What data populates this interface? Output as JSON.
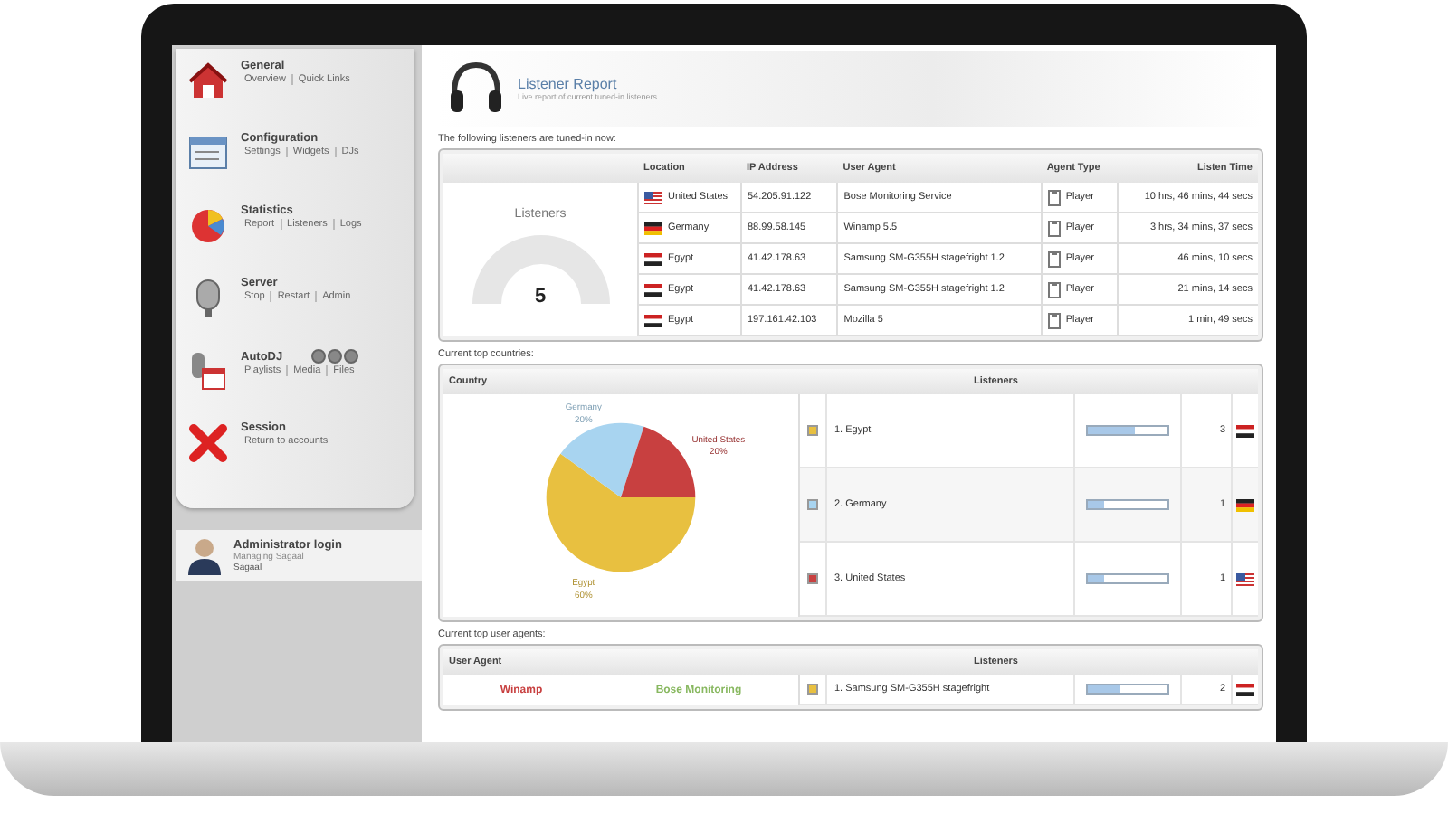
{
  "sidebar": {
    "sections": [
      {
        "kind": "home",
        "title": "General",
        "links": [
          "Overview",
          "Quick Links"
        ]
      },
      {
        "kind": "config",
        "title": "Configuration",
        "links": [
          "Settings",
          "Widgets",
          "DJs"
        ]
      },
      {
        "kind": "stats",
        "title": "Statistics",
        "links": [
          "Report",
          "Listeners",
          "Logs"
        ]
      },
      {
        "kind": "server",
        "title": "Server",
        "links": [
          "Stop",
          "Restart",
          "Admin"
        ]
      },
      {
        "kind": "autodj",
        "title": "AutoDJ",
        "links": [
          "Playlists",
          "Media",
          "Files"
        ]
      },
      {
        "kind": "session",
        "title": "Session",
        "links": [
          "Return to accounts"
        ]
      }
    ],
    "account": {
      "title": "Administrator login",
      "subtitle": "Managing Sagaal",
      "user": "Sagaal"
    }
  },
  "header": {
    "title": "Listener Report",
    "subtitle": "Live report of current tuned-in listeners"
  },
  "listeners": {
    "caption": "The following listeners are tuned-in now:",
    "gauge_label": "Listeners",
    "gauge_value": "5",
    "columns": [
      "Location",
      "IP Address",
      "User Agent",
      "Agent Type",
      "Listen Time"
    ],
    "rows": [
      {
        "kind": "us",
        "location": "United States",
        "ip": "54.205.91.122",
        "agent": "Bose Monitoring Service",
        "type": "Player",
        "time": "10 hrs, 46 mins, 44 secs"
      },
      {
        "kind": "de",
        "location": "Germany",
        "ip": "88.99.58.145",
        "agent": "Winamp 5.5",
        "type": "Player",
        "time": "3 hrs, 34 mins, 37 secs"
      },
      {
        "kind": "eg",
        "location": "Egypt",
        "ip": "41.42.178.63",
        "agent": "Samsung SM-G355H stagefright 1.2",
        "type": "Player",
        "time": "46 mins, 10 secs"
      },
      {
        "kind": "eg",
        "location": "Egypt",
        "ip": "41.42.178.63",
        "agent": "Samsung SM-G355H stagefright 1.2",
        "type": "Player",
        "time": "21 mins, 14 secs"
      },
      {
        "kind": "eg",
        "location": "Egypt",
        "ip": "197.161.42.103",
        "agent": "Mozilla 5",
        "type": "Player",
        "time": "1 min, 49 secs"
      }
    ]
  },
  "countries": {
    "caption": "Current top countries:",
    "columns": [
      "Country",
      "Listeners"
    ],
    "chart_data": {
      "type": "pie",
      "categories": [
        "Egypt",
        "Germany",
        "United States"
      ],
      "values": [
        60,
        20,
        20
      ],
      "value_labels": [
        "60%",
        "20%",
        "20%"
      ]
    },
    "rows": [
      {
        "color": "#e8c040",
        "name": "1. Egypt",
        "level": 0.6,
        "count": "3",
        "kind": "eg"
      },
      {
        "color": "#a8d4f0",
        "name": "2. Germany",
        "level": 0.2,
        "count": "1",
        "kind": "de"
      },
      {
        "color": "#c84040",
        "name": "3. United States",
        "level": 0.2,
        "count": "1",
        "kind": "us"
      }
    ]
  },
  "agents": {
    "caption": "Current top user agents:",
    "columns": [
      "User Agent",
      "Listeners"
    ],
    "pie_labels": [
      {
        "color": "#c84040",
        "text": "Winamp"
      },
      {
        "color": "#88b860",
        "text": "Bose Monitoring"
      }
    ],
    "rows": [
      {
        "color": "#e8c040",
        "name": "1. Samsung SM-G355H stagefright",
        "level": 0.4,
        "count": "2",
        "kind": "eg"
      }
    ]
  }
}
